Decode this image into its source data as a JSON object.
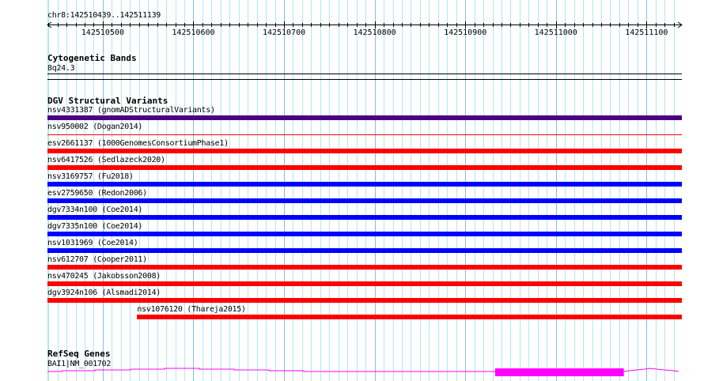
{
  "view": {
    "region_label": "chr8:142510439..142511139",
    "start": 142510439,
    "end": 142511139
  },
  "ruler": {
    "ticks": [
      "142510500",
      "142510600",
      "142510700",
      "142510800",
      "142510900",
      "142511000",
      "142511100"
    ]
  },
  "cytoband": {
    "title": "Cytogenetic Bands",
    "band": "8q24.3"
  },
  "dgv": {
    "title": "DGV Structural Variants",
    "variants": [
      {
        "label": "nsv4331387 (gnomADStructuralVariants)",
        "color": "#4b0082",
        "start": 142510439,
        "end": 142511139,
        "thin": false
      },
      {
        "label": "nsv950002 (Dogan2014)",
        "color": "#ff0000",
        "start": 142510439,
        "end": 142511139,
        "thin": true
      },
      {
        "label": "esv2661137 (1000GenomesConsortiumPhase1)",
        "color": "#ff0000",
        "start": 142510439,
        "end": 142511139,
        "thin": false
      },
      {
        "label": "nsv6417526 (Sedlazeck2020)",
        "color": "#ff0000",
        "start": 142510439,
        "end": 142511139,
        "thin": false
      },
      {
        "label": "nsv3169757 (Fu2018)",
        "color": "#0000ff",
        "start": 142510439,
        "end": 142511139,
        "thin": false
      },
      {
        "label": "esv2759650 (Redon2006)",
        "color": "#0000ff",
        "start": 142510439,
        "end": 142511139,
        "thin": false
      },
      {
        "label": "dgv7334n100 (Coe2014)",
        "color": "#0000ff",
        "start": 142510439,
        "end": 142511139,
        "thin": false
      },
      {
        "label": "dgv7335n100 (Coe2014)",
        "color": "#0000ff",
        "start": 142510439,
        "end": 142511139,
        "thin": false
      },
      {
        "label": "nsv1031969 (Coe2014)",
        "color": "#0000ff",
        "start": 142510439,
        "end": 142511139,
        "thin": false
      },
      {
        "label": "nsv612707 (Cooper2011)",
        "color": "#ff0000",
        "start": 142510439,
        "end": 142511139,
        "thin": false
      },
      {
        "label": "nsv470245 (Jakobsson2008)",
        "color": "#ff0000",
        "start": 142510439,
        "end": 142511139,
        "thin": false
      },
      {
        "label": "dgv3924n106 (Alsmadi2014)",
        "color": "#ff0000",
        "start": 142510439,
        "end": 142511139,
        "thin": false
      },
      {
        "label": "nsv1076120 (Thareja2015)",
        "color": "#ff0000",
        "start": 142510538,
        "end": 142511139,
        "thin": false
      }
    ]
  },
  "refseq": {
    "title": "RefSeq Genes",
    "gene": "BAI1|NM_001702",
    "color": "#ff00ff",
    "exon_start": 142510933,
    "exon_end": 142511075
  },
  "colors": {
    "grid_minor": "#b0e8f0",
    "grid_major": "#80c0e0"
  }
}
